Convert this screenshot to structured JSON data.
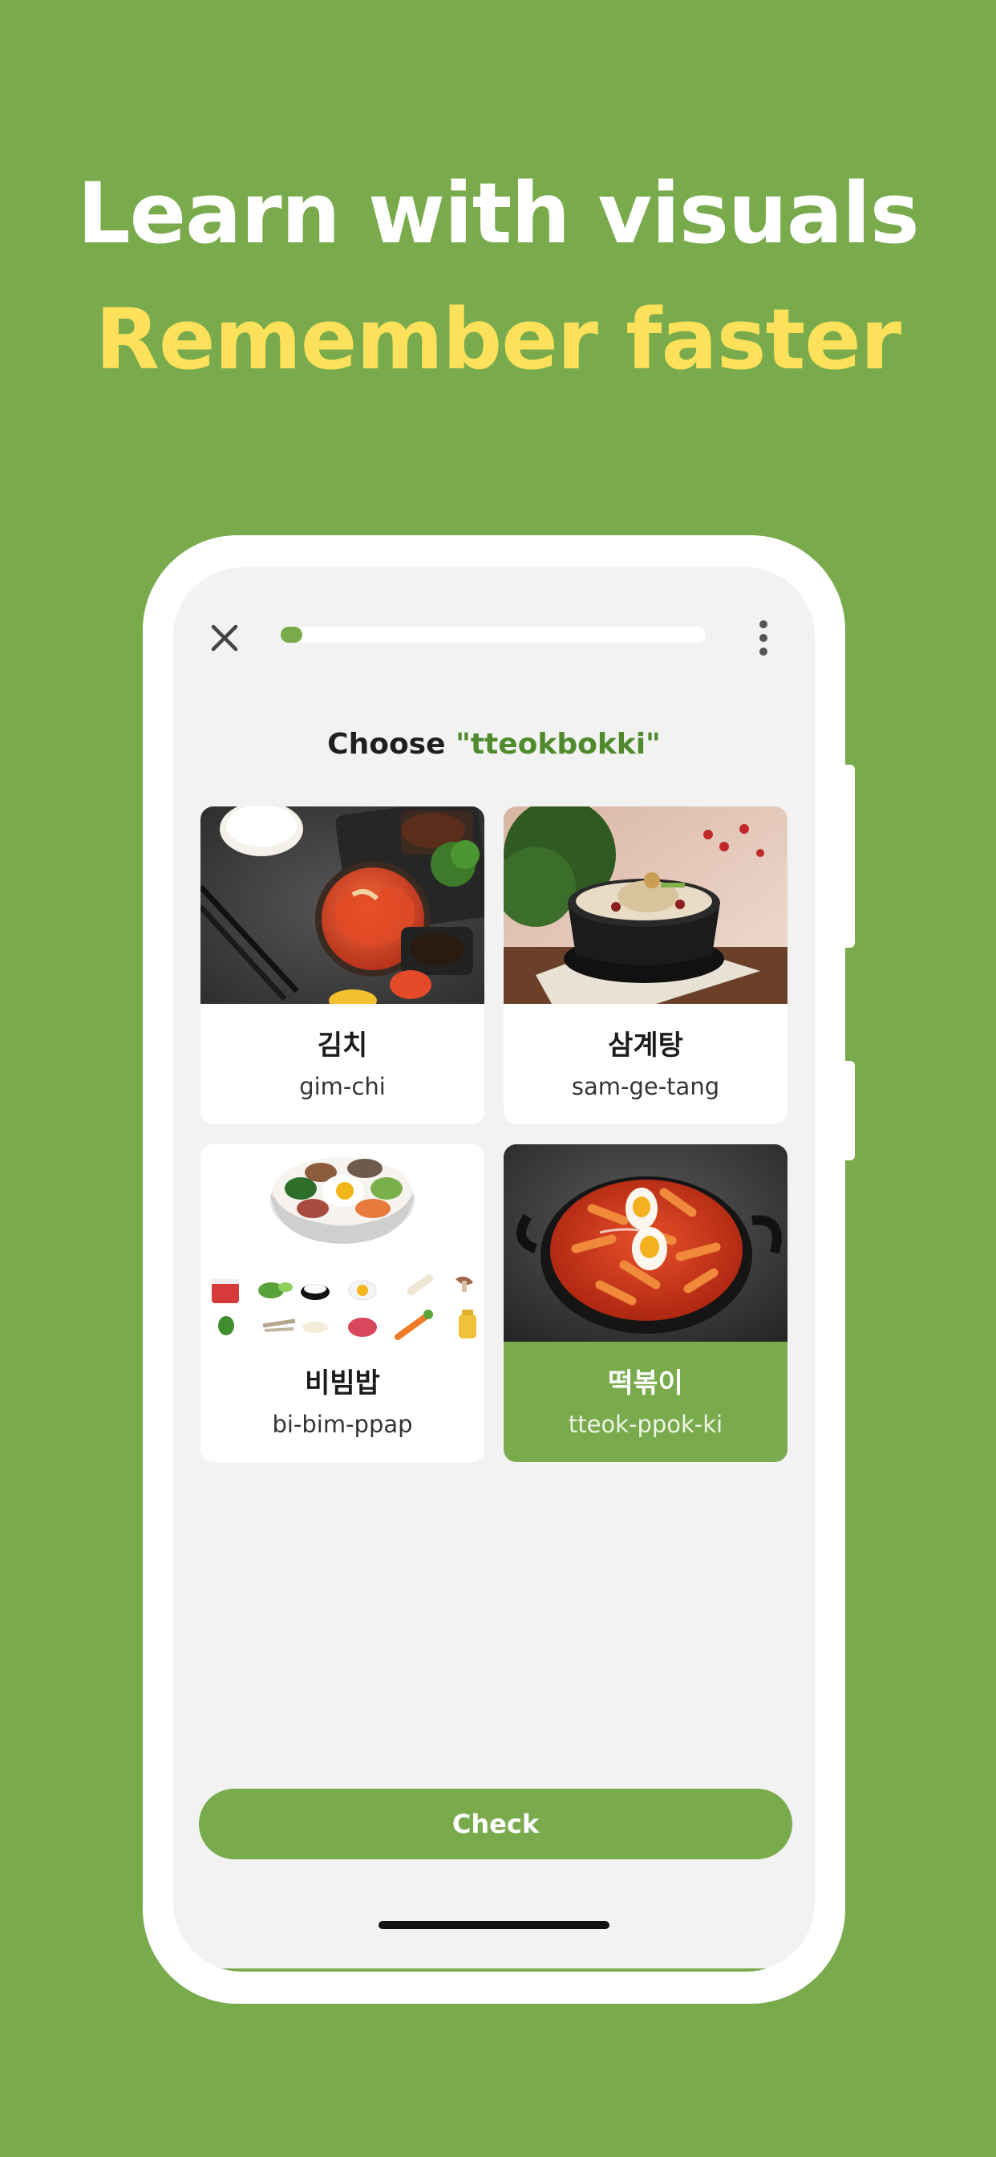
{
  "promo": {
    "headline_line1": "Learn with visuals",
    "headline_line2": "Remember faster"
  },
  "colors": {
    "background": "#79ab4d",
    "accent_yellow": "#fde15a",
    "target_text": "#4f8b2c",
    "screen": "#f2f2f2"
  },
  "topbar": {
    "close_icon": "close-icon",
    "more_icon": "more-vertical-icon",
    "progress_fraction": 0.05
  },
  "question": {
    "prefix": "Choose ",
    "target": "\"tteokbokki\""
  },
  "options": [
    {
      "korean": "김치",
      "romanization": "gim-chi",
      "image": "kimchi-photo",
      "selected": false
    },
    {
      "korean": "삼계탕",
      "romanization": "sam-ge-tang",
      "image": "samgyetang-photo",
      "selected": false
    },
    {
      "korean": "비빔밥",
      "romanization": "bi-bim-ppap",
      "image": "bibimbap-illustration",
      "selected": false
    },
    {
      "korean": "떡볶이",
      "romanization": "tteok-ppok-ki",
      "image": "tteokbokki-photo",
      "selected": true
    }
  ],
  "actions": {
    "check_label": "Check"
  }
}
